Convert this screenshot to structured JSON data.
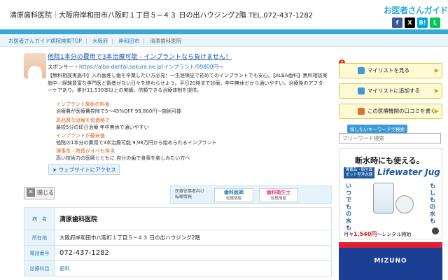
{
  "header": {
    "title": "清原歯科医院｜大阪府岸和田市八阪町１丁目５−４３ 日の出ハウジング2階 TEL.072-437-1282",
    "logo": "お医者さんガイド",
    "social": [
      {
        "label": "f",
        "color": "#3b5998",
        "icon": "facebook-icon"
      },
      {
        "label": "X",
        "color": "#000000",
        "icon": "x-icon"
      },
      {
        "label": "B!",
        "color": "#00a4de",
        "icon": "hatena-icon"
      },
      {
        "label": "L",
        "color": "#06c755",
        "icon": "line-icon"
      }
    ]
  },
  "breadcrumb": [
    "お医者さんガイド病院検索TOP",
    "大阪府",
    "岸和田市",
    "清原歯科医院"
  ],
  "ad": {
    "title": "他院1本分の費用で3本治療可能 - インプラントなら負けません！",
    "sponsor_label": "スポンサー・",
    "sponsor_url": "https://alba-dental.sakura.ne.jp/インプラント/99800円〜",
    "body": "【無料相談実施中】入れ歯差し歯を卒業したい方必見！一生涯保証で初めてのインプラントでも安心。【ALBA歯科】無料相談実施中／経験豊富な専門医と衛者がない日々を終わらせよう。平日20時まで診療。年中無休だから通いやすい。治療後のアフターケアあり。累計11,539本以上の実績。信頼できる治療体制を提供。",
    "features": [
      {
        "title": "インプラント施術の料金",
        "desc": "治療費が医療費控除で5〜45%OFF 99,800円〜施術可能"
      },
      {
        "title": "高品質な治療を低価格で",
        "desc": "最短5分の印日治療 年中無休で通いやすい"
      },
      {
        "title": "インプラントが最安値",
        "desc": "他院の1本分の費用で3本治療可能 9,98万円から始められるインプラント"
      },
      {
        "title": "理事長・院長がオペも担当",
        "desc": "高い技術力の医師とともに 自分の歯で食事を楽しみたい方へ"
      }
    ],
    "visit_label": "ウェブサイトにアクセス"
  },
  "close_label": "閉じる",
  "jobs": {
    "label_line1": "医療従事者向け",
    "label_line2": "転職情報",
    "buttons": [
      {
        "name": "歯科医師",
        "sub": "転職情報",
        "color": "#2a78b8"
      },
      {
        "name": "歯科衛生士",
        "sub": "転職情報",
        "color": "#e0407a"
      }
    ]
  },
  "info_table": [
    {
      "key": "病　名",
      "value": "清原歯科医院"
    },
    {
      "key": "所在地",
      "value": "大阪府岸和田市八阪町１丁目５−４３ 日の出ハウジング2階"
    },
    {
      "key": "電話番号",
      "value": "072-437-1282"
    },
    {
      "key": "診療科目",
      "value": "歯科"
    }
  ],
  "sidebar": {
    "badge": "0",
    "buttons": [
      "マイリストを見る",
      "マイリストに追加する",
      "この医療機関の口コミを書く"
    ],
    "keyword_label": "探したいキーワードで検索",
    "keyword_placeholder": "フリーワード検索"
  },
  "banner": {
    "title": "断水時にも使える。",
    "tag": "備蓄品・衛生面 ボット型浄水器",
    "brand": "Lifewater Jug",
    "left_text": "いつでもの水も",
    "right_text": "もしもの水も",
    "price_prefix": "月々",
    "price": "1,540円",
    "price_suffix": "〜レンタル開始",
    "badge": "i"
  },
  "banner2": {
    "brand": "MIZUNO"
  }
}
